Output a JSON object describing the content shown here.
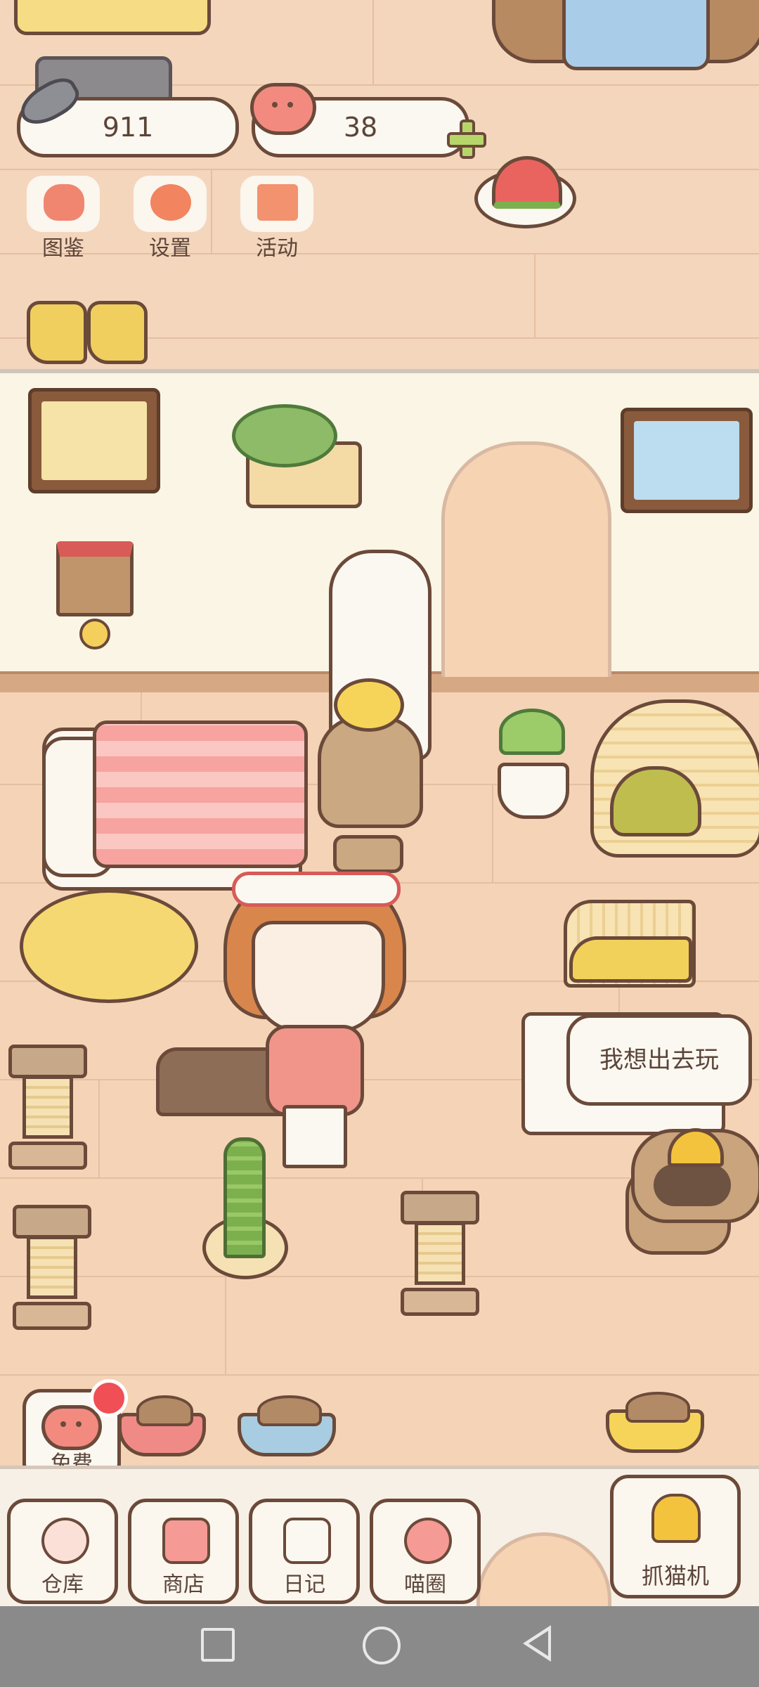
{
  "currency": {
    "fish_count": "911",
    "heart_count": "38"
  },
  "top_menu": [
    {
      "label": "图鉴",
      "icon": "cat-head-icon"
    },
    {
      "label": "设置",
      "icon": "gear-icon"
    },
    {
      "label": "活动",
      "icon": "gift-icon"
    }
  ],
  "speech_bubble": "我想出去玩",
  "free_button": {
    "label": "免费"
  },
  "bottom_menu": [
    {
      "label": "仓库",
      "icon": "storage-box-icon"
    },
    {
      "label": "商店",
      "icon": "shop-icon"
    },
    {
      "label": "日记",
      "icon": "diary-icon"
    },
    {
      "label": "喵圈",
      "icon": "cat-planet-icon"
    }
  ],
  "claw_machine": {
    "label": "抓猫机",
    "icon": "claw-icon"
  },
  "colors": {
    "outline": "#6b4a3a",
    "accent_pink": "#f28a80",
    "accent_green": "#b7d66a",
    "badge_red": "#ef4f55"
  }
}
